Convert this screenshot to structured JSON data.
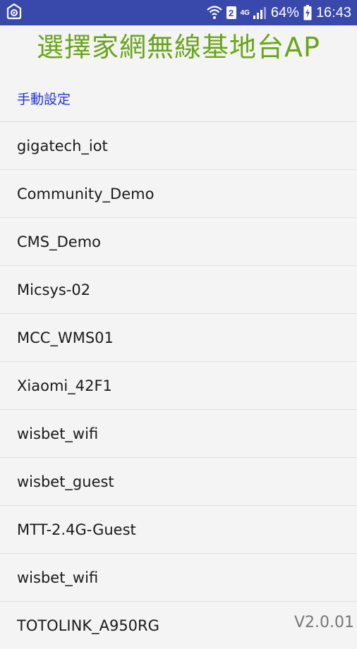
{
  "statusbar": {
    "sim_number": "2",
    "network_type": "4G",
    "battery": "64%",
    "time": "16:43",
    "icons": [
      "notification-app-icon",
      "wifi-icon",
      "sim-icon",
      "signal-icon",
      "battery-charging-icon"
    ]
  },
  "header": {
    "title": "選擇家網無線基地台AP"
  },
  "manual_setup": {
    "label": "手動設定"
  },
  "networks": [
    "gigatech_iot",
    "Community_Demo",
    "CMS_Demo",
    "Micsys-02",
    "MCC_WMS01",
    "Xiaomi_42F1",
    "wisbet_wifi",
    "wisbet_guest",
    "MTT-2.4G-Guest",
    "wisbet_wifi",
    "TOTOLINK_A950RG"
  ],
  "footer": {
    "version": "V2.0.01"
  },
  "colors": {
    "statusbar": "#3949ab",
    "title": "#6aa51c",
    "link": "#2233dd"
  }
}
